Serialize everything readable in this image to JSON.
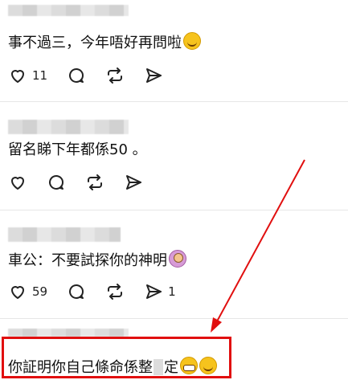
{
  "posts": [
    {
      "text": "事不過三，今年唔好再問啦",
      "emoji": "laughing-tears-emoji",
      "likes": "11",
      "reposts_count": ""
    },
    {
      "text": "留名睇下年都係50 。",
      "emoji": "",
      "likes": "",
      "reposts_count": ""
    },
    {
      "text": "車公：不要試探你的神明",
      "emoji": "woman-gesturing-emoji",
      "likes": "59",
      "reposts_count": "1"
    },
    {
      "text_before_redaction": "你証明你自己條命係整",
      "text_after_redaction": "定",
      "emoji": [
        "grimacing-emoji",
        "smiling-emoji"
      ]
    }
  ],
  "annotation": {
    "box_color": "#e10f0f",
    "arrow_color": "#e10f0f"
  },
  "icons": [
    "heart-icon",
    "comment-icon",
    "repost-icon",
    "share-icon"
  ]
}
